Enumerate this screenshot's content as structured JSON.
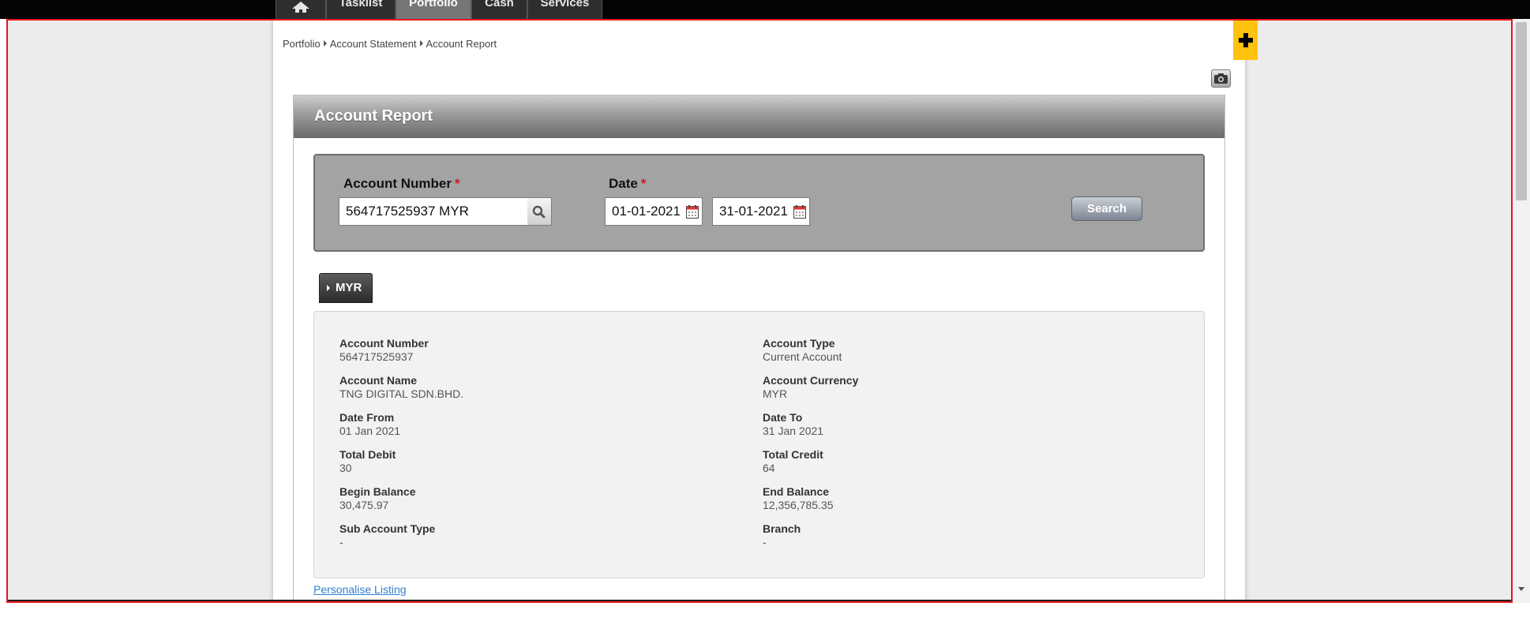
{
  "nav": {
    "tabs": [
      {
        "label": "",
        "icon": "home-icon"
      },
      {
        "label": "Tasklist"
      },
      {
        "label": "Portfolio",
        "active": true
      },
      {
        "label": "Cash"
      },
      {
        "label": "Services"
      }
    ]
  },
  "breadcrumb": [
    "Portfolio",
    "Account Statement",
    "Account Report"
  ],
  "panel": {
    "title": "Account Report"
  },
  "search": {
    "account_number_label": "Account Number",
    "account_number_value": "564717525937 MYR",
    "date_label": "Date",
    "required_mark": "*",
    "date_from_value": "01-01-2021",
    "date_to_value": "31-01-2021",
    "search_button": "Search"
  },
  "currency_tab": "MYR",
  "details": {
    "left": [
      {
        "label": "Account Number",
        "value": "564717525937"
      },
      {
        "label": "Account Name",
        "value": "TNG DIGITAL SDN.BHD."
      },
      {
        "label": "Date From",
        "value": "01 Jan 2021"
      },
      {
        "label": "Total Debit",
        "value": "30"
      },
      {
        "label": "Begin Balance",
        "value": "30,475.97"
      },
      {
        "label": "Sub Account Type",
        "value": "-"
      }
    ],
    "right": [
      {
        "label": "Account Type",
        "value": "Current Account"
      },
      {
        "label": "Account Currency",
        "value": "MYR"
      },
      {
        "label": "Date To",
        "value": "31 Jan 2021"
      },
      {
        "label": "Total Credit",
        "value": "64"
      },
      {
        "label": "End Balance",
        "value": "12,356,785.35"
      },
      {
        "label": "Branch",
        "value": "-"
      }
    ]
  },
  "personalise_link": "Personalise Listing",
  "colors": {
    "accent_yellow": "#ffc20e",
    "required_red": "#d0181f",
    "link_blue": "#2f7fd0",
    "frame_red": "#e8141b"
  },
  "icons": {
    "plus": "plus-icon",
    "camera": "camera-icon",
    "lookup": "search-icon",
    "calendar": "calendar-icon"
  }
}
